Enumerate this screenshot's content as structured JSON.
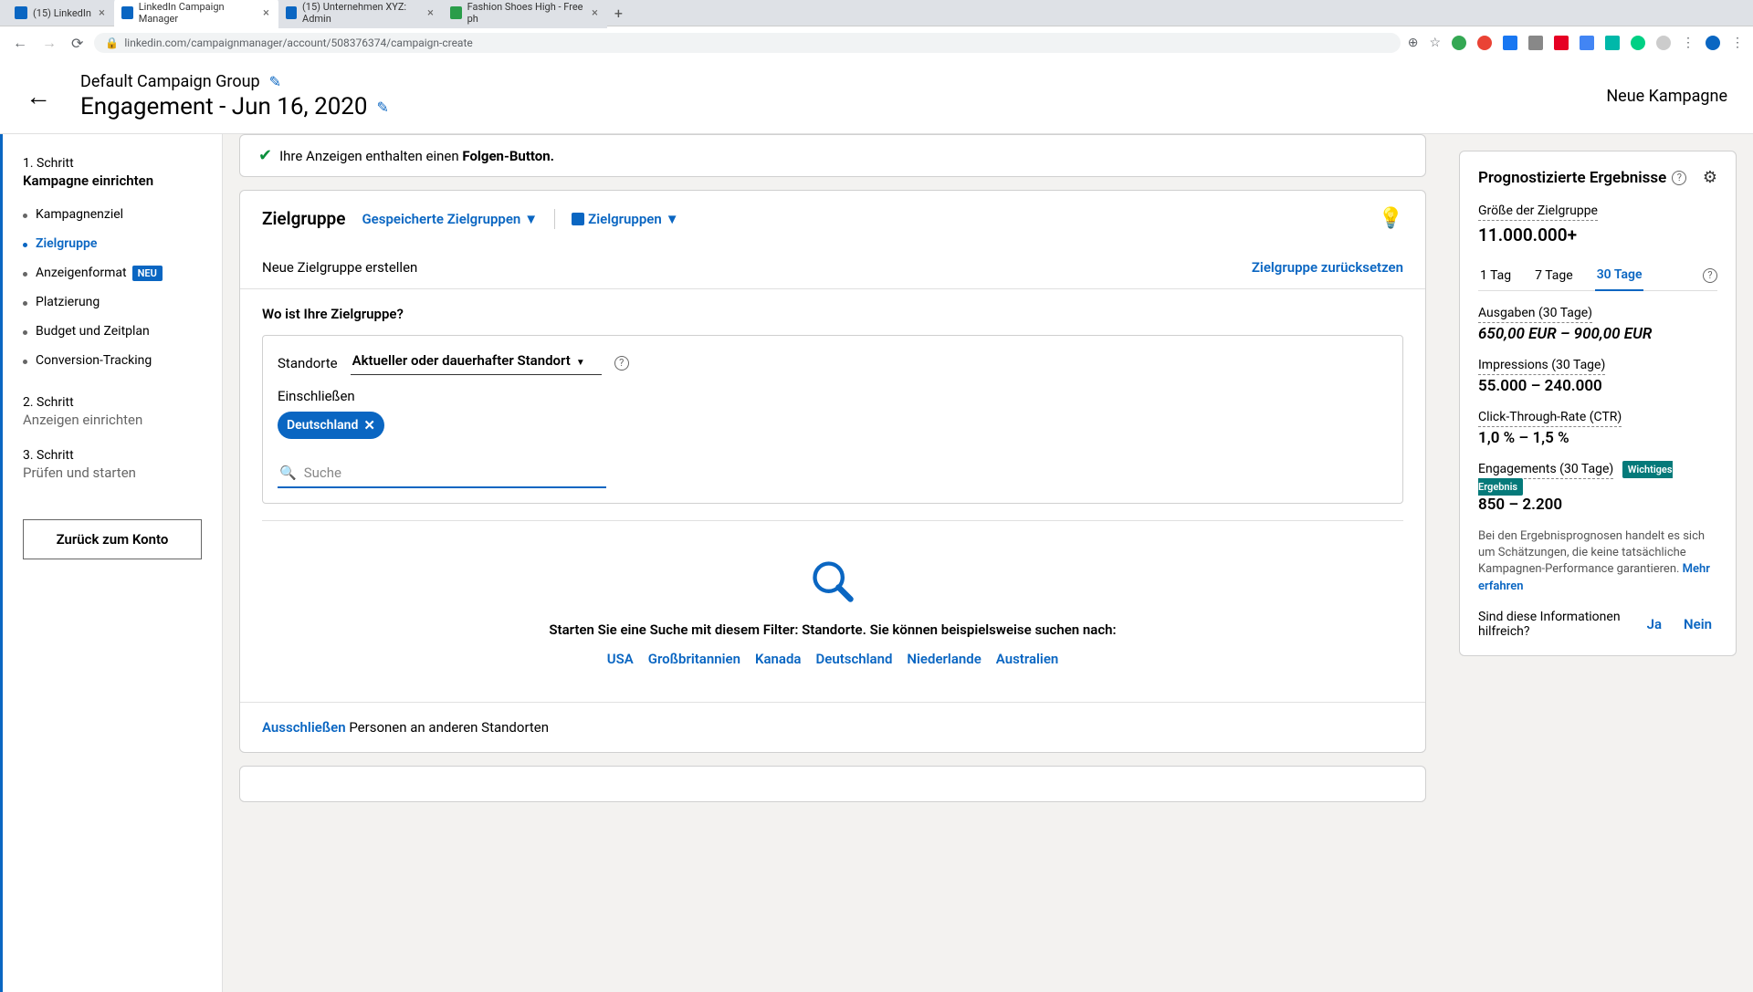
{
  "browser": {
    "tabs": [
      {
        "title": "(15) LinkedIn",
        "active": false,
        "favicon": "#0a66c2"
      },
      {
        "title": "LinkedIn Campaign Manager",
        "active": true,
        "favicon": "#0a66c2"
      },
      {
        "title": "(15) Unternehmen XYZ: Admin",
        "active": false,
        "favicon": "#0a66c2"
      },
      {
        "title": "Fashion Shoes High - Free ph",
        "active": false,
        "favicon": "#2a9d4a"
      }
    ],
    "url": "linkedin.com/campaignmanager/account/508376374/campaign-create"
  },
  "header": {
    "group_title": "Default Campaign Group",
    "campaign_title": "Engagement - Jun 16, 2020",
    "status": "Neue Kampagne"
  },
  "sidebar": {
    "step1_label": "1. Schritt",
    "step1_title": "Kampagne einrichten",
    "items": [
      "Kampagnenziel",
      "Zielgruppe",
      "Anzeigenformat",
      "Platzierung",
      "Budget und Zeitplan",
      "Conversion-Tracking"
    ],
    "new_badge": "NEU",
    "step2_label": "2. Schritt",
    "step2_title": "Anzeigen einrichten",
    "step3_label": "3. Schritt",
    "step3_title": "Prüfen und starten",
    "back_account": "Zurück zum Konto"
  },
  "info": {
    "prefix": "Ihre Anzeigen enthalten einen ",
    "bold": "Folgen-Button."
  },
  "audience": {
    "title": "Zielgruppe",
    "saved": "Gespeicherte Zielgruppen",
    "groups": "Zielgruppen",
    "create": "Neue Zielgruppe erstellen",
    "reset": "Zielgruppe zurücksetzen",
    "where_q": "Wo ist Ihre Zielgruppe?",
    "loc_label": "Standorte",
    "loc_select": "Aktueller oder dauerhafter Standort",
    "include": "Einschließen",
    "chip": "Deutschland",
    "search_placeholder": "Suche",
    "search_hint": "Starten Sie eine Suche mit diesem Filter: Standorte. Sie können beispielsweise suchen nach:",
    "suggestions": [
      "USA",
      "Großbritannien",
      "Kanada",
      "Deutschland",
      "Niederlande",
      "Australien"
    ],
    "exclude_link": "Ausschließen",
    "exclude_text": " Personen an anderen Standorten"
  },
  "forecast": {
    "title": "Prognostizierte Ergebnisse",
    "size_label": "Größe der Zielgruppe",
    "size_value": "11.000.000+",
    "tabs": [
      "1 Tag",
      "7 Tage",
      "30 Tage"
    ],
    "spend_label": "Ausgaben (30 Tage)",
    "spend_value": "650,00 EUR – 900,00 EUR",
    "impr_label": "Impressions (30 Tage)",
    "impr_value": "55.000 – 240.000",
    "ctr_label": "Click-Through-Rate (CTR)",
    "ctr_value": "1,0 % – 1,5 %",
    "eng_label": "Engagements (30 Tage)",
    "eng_badge": "Wichtiges Ergebnis",
    "eng_value": "850 – 2.200",
    "disclaimer": "Bei den Ergebnisprognosen handelt es sich um Schätzungen, die keine tatsächliche Kampagnen-Performance garantieren. ",
    "learn_more": "Mehr erfahren",
    "feedback_q": "Sind diese Informationen hilfreich?",
    "yes": "Ja",
    "no": "Nein"
  }
}
